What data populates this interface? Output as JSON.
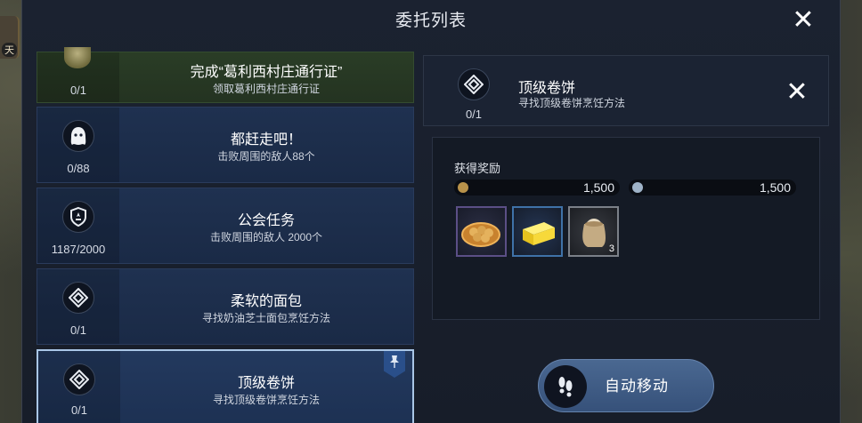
{
  "header": {
    "title": "委托列表"
  },
  "side_badge": "天",
  "quests": [
    {
      "name": "完成“葛利西村庄通行证”",
      "desc": "领取葛利西村庄通行证",
      "count": "0/1",
      "icon": "seed-icon",
      "style": "green"
    },
    {
      "name": "都赶走吧！",
      "desc": "击败周围的敌人88个",
      "count": "0/88",
      "icon": "ghost-icon",
      "style": "blue"
    },
    {
      "name": "公会任务",
      "desc": "击败周围的敌人 2000个",
      "count": "1187/2000",
      "icon": "guild-shield-icon",
      "style": "blue"
    },
    {
      "name": "柔软的面包",
      "desc": "寻找奶油芝士面包烹饪方法",
      "count": "0/1",
      "icon": "recipe-diamond-icon",
      "style": "blue"
    },
    {
      "name": "顶级卷饼",
      "desc": "寻找顶级卷饼烹饪方法",
      "count": "0/1",
      "icon": "recipe-diamond-icon",
      "style": "selected",
      "pinned": true
    }
  ],
  "detail": {
    "name": "顶级卷饼",
    "desc": "寻找顶级卷饼烹饪方法",
    "count": "0/1",
    "icon": "recipe-diamond-icon"
  },
  "rewards": {
    "label": "获得奖励",
    "currency_1": {
      "value": "1,500",
      "icon": "gold-coin-icon",
      "color": "#b8924a"
    },
    "currency_2": {
      "value": "1,500",
      "icon": "silver-coin-icon",
      "color": "#9fb3c8"
    },
    "items": [
      {
        "icon": "bread-basket-icon",
        "quantity": "",
        "rarity": "purple"
      },
      {
        "icon": "cheese-block-icon",
        "quantity": "",
        "rarity": "blue"
      },
      {
        "icon": "flour-sack-icon",
        "quantity": "3",
        "rarity": "grey"
      }
    ]
  },
  "auto_move": {
    "label": "自动移动",
    "icon": "footsteps-icon"
  }
}
